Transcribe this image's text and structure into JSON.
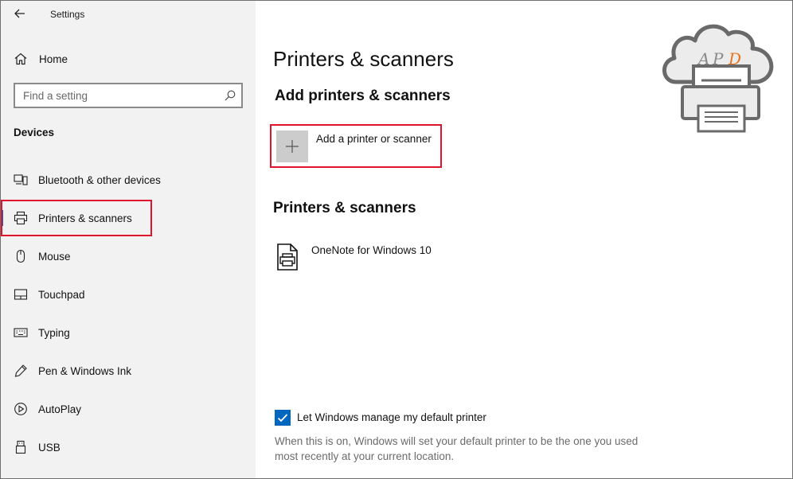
{
  "app": {
    "title": "Settings"
  },
  "sidebar": {
    "home_label": "Home",
    "search_placeholder": "Find a setting",
    "section_title": "Devices",
    "items": [
      {
        "label": "Bluetooth & other devices",
        "icon": "bluetooth-devices-icon",
        "active": false
      },
      {
        "label": "Printers & scanners",
        "icon": "printer-icon",
        "active": true
      },
      {
        "label": "Mouse",
        "icon": "mouse-icon",
        "active": false
      },
      {
        "label": "Touchpad",
        "icon": "touchpad-icon",
        "active": false
      },
      {
        "label": "Typing",
        "icon": "keyboard-icon",
        "active": false
      },
      {
        "label": "Pen & Windows Ink",
        "icon": "pen-icon",
        "active": false
      },
      {
        "label": "AutoPlay",
        "icon": "autoplay-icon",
        "active": false
      },
      {
        "label": "USB",
        "icon": "usb-icon",
        "active": false
      }
    ]
  },
  "main": {
    "title": "Printers & scanners",
    "add_section_title": "Add printers & scanners",
    "add_button_label": "Add a printer or scanner",
    "list_section_title": "Printers & scanners",
    "printers": [
      {
        "name": "OneNote for Windows 10",
        "icon": "printer-document-icon"
      }
    ],
    "default_printer": {
      "checked": true,
      "label": "Let Windows manage my default printer",
      "help": "When this is on, Windows will set your default printer to be the one you used most recently at your current location."
    }
  },
  "logo": {
    "text": "APD",
    "icon": "cloud-printer-logo"
  },
  "colors": {
    "accent": "#0067c0",
    "highlight_box": "#e0142c",
    "sidebar_bg": "#f2f2f2",
    "add_tile_bg": "#cccccc"
  }
}
